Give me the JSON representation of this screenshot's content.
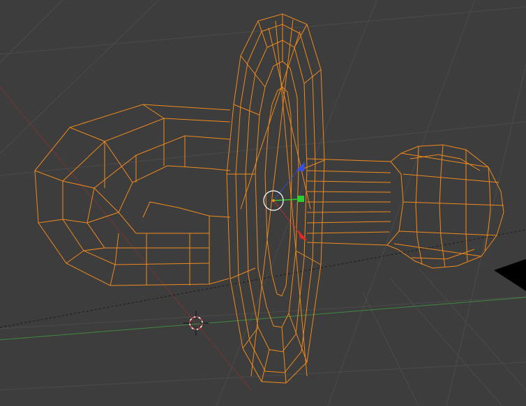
{
  "viewport": {
    "view": "3d-viewport",
    "shading": "wireframe",
    "background_color": "#3d3d3d",
    "grid_color": "#4a4a4a",
    "selection_color": "#f08a1c",
    "axis_x_color": "#a23a3a",
    "axis_y_color": "#3f8a3f"
  },
  "object": {
    "name": "pacifier",
    "selected": true,
    "parts": [
      "ring-handle",
      "shield",
      "nipple"
    ]
  },
  "gizmo": {
    "type": "translate",
    "arrows": [
      {
        "axis": "z",
        "color": "#3650e6"
      },
      {
        "axis": "y",
        "color": "#2ecc2e"
      },
      {
        "axis": "x",
        "color": "#e02a2a"
      }
    ]
  },
  "cursor_3d": {
    "icon": "crosshair-icon"
  }
}
